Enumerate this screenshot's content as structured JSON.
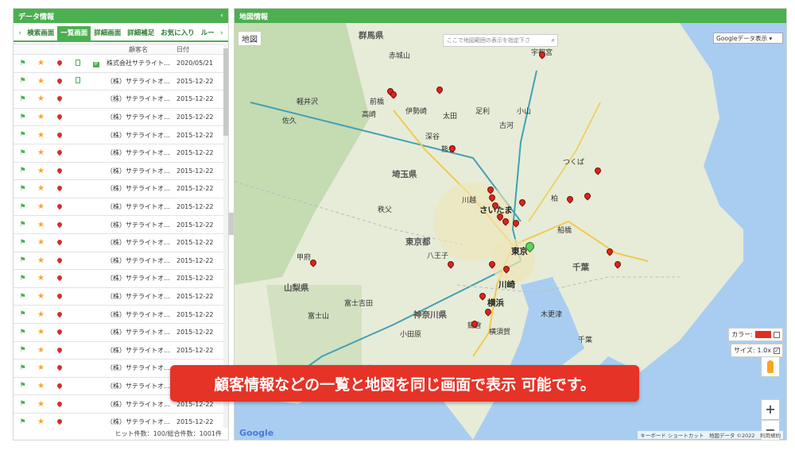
{
  "left_panel": {
    "title": "データ情報",
    "collapse_glyph": "‹",
    "tabs": [
      "検索画面",
      "一覧画面",
      "詳細画面",
      "詳細補足",
      "お気に入り",
      "ルー"
    ],
    "active_tab": 1,
    "columns": [
      "顧客名",
      "日付"
    ],
    "rows": [
      {
        "name": "株式会社サテライト…",
        "date": "2020/05/21",
        "doc2": true,
        "tag": true
      },
      {
        "name": "（株）サテライトオ…",
        "date": "2015-12-22",
        "doc2": true,
        "tag": false
      },
      {
        "name": "（株）サテライトオ…",
        "date": "2015-12-22"
      },
      {
        "name": "（株）サテライトオ…",
        "date": "2015-12-22"
      },
      {
        "name": "（株）サテライトオ…",
        "date": "2015-12-22"
      },
      {
        "name": "（株）サテライトオ…",
        "date": "2015-12-22"
      },
      {
        "name": "（株）サテライトオ…",
        "date": "2015-12-22"
      },
      {
        "name": "（株）サテライトオ…",
        "date": "2015-12-22"
      },
      {
        "name": "（株）サテライトオ…",
        "date": "2015-12-22"
      },
      {
        "name": "（株）サテライトオ…",
        "date": "2015-12-22"
      },
      {
        "name": "（株）サテライトオ…",
        "date": "2015-12-22"
      },
      {
        "name": "（株）サテライトオ…",
        "date": "2015-12-22"
      },
      {
        "name": "（株）サテライトオ…",
        "date": "2015-12-22"
      },
      {
        "name": "（株）サテライトオ…",
        "date": "2015-12-22"
      },
      {
        "name": "（株）サテライトオ…",
        "date": "2015-12-22"
      },
      {
        "name": "（株）サテライトオ…",
        "date": "2015-12-22"
      },
      {
        "name": "（株）サテライトオ…",
        "date": "2015-12-22"
      },
      {
        "name": "（株）サテライトオ…",
        "date": "2015-12-22"
      },
      {
        "name": "（株）サテライトオ…",
        "date": "2015-12-22"
      },
      {
        "name": "（株）サテライトオ…",
        "date": "2015-12-22"
      },
      {
        "name": "（株）サテライトオ…",
        "date": "2015-12-22"
      }
    ],
    "footer": "ヒット件数：100/総合件数：1001件"
  },
  "right_panel": {
    "title": "地図情報",
    "map_type": "地図",
    "search_placeholder": "ここで地図範囲の表示を指定下さ",
    "display_select": "Googleデータ表示",
    "color_label": "カラー:",
    "size_label": "サイズ:",
    "size_value": "1.0x",
    "zoom_in": "+",
    "zoom_out": "−",
    "logo": "Google",
    "attribution": "キーボード ショートカット　地図データ ©2022　利用規約"
  },
  "map_labels": {
    "big": [
      "群馬県",
      "埼玉県",
      "東京都",
      "山梨県",
      "神奈川県",
      "千葉"
    ],
    "cities": [
      "前橋",
      "高崎",
      "伊勢崎",
      "太田",
      "足利",
      "宇都宮",
      "小山",
      "古河",
      "深谷",
      "熊谷",
      "秩父",
      "さいたま",
      "川越",
      "八王子",
      "東京",
      "川崎",
      "横浜",
      "甲府",
      "富士山",
      "つくば",
      "柏",
      "船橋",
      "千葉",
      "木更津",
      "鎌倉",
      "横須賀",
      "小田原",
      "富士吉田",
      "赤城山",
      "軽井沢",
      "佐久"
    ]
  },
  "banner": "顧客情報などの一覧と地図を同じ画面で表示 可能です。",
  "colors": {
    "accent": "#4caf50",
    "banner": "#e53327",
    "pin": "#d7261e",
    "pin_selected": "#5fd35a",
    "sea": "#a9cdf0",
    "land": "#e7ecd8"
  }
}
